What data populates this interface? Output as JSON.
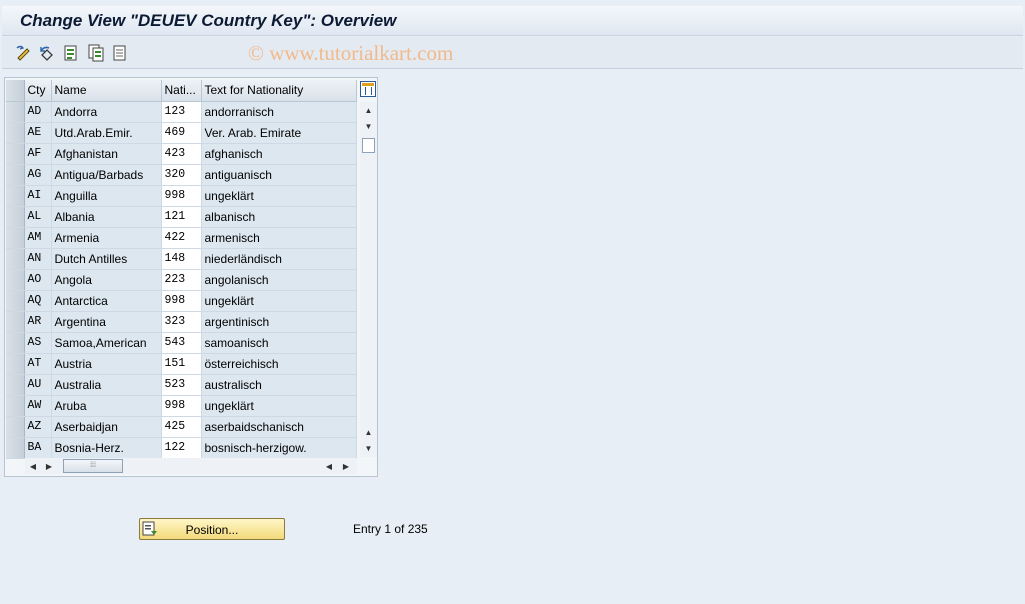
{
  "title": "Change View \"DEUEV Country Key\": Overview",
  "watermark": "© www.tutorialkart.com",
  "toolbar": {
    "icons": [
      "edit-pencil-icon",
      "undo-icon",
      "new-entries-icon",
      "copy-entries-icon",
      "delete-icon"
    ]
  },
  "table": {
    "columns": [
      "Cty",
      "Name",
      "Nati...",
      "Text for Nationality"
    ],
    "rows": [
      {
        "cty": "AD",
        "name": "Andorra",
        "nat": "123",
        "text": "andorranisch"
      },
      {
        "cty": "AE",
        "name": "Utd.Arab.Emir.",
        "nat": "469",
        "text": "Ver. Arab. Emirate"
      },
      {
        "cty": "AF",
        "name": "Afghanistan",
        "nat": "423",
        "text": "afghanisch"
      },
      {
        "cty": "AG",
        "name": "Antigua/Barbads",
        "nat": "320",
        "text": "antiguanisch"
      },
      {
        "cty": "AI",
        "name": "Anguilla",
        "nat": "998",
        "text": "ungeklärt"
      },
      {
        "cty": "AL",
        "name": "Albania",
        "nat": "121",
        "text": "albanisch"
      },
      {
        "cty": "AM",
        "name": "Armenia",
        "nat": "422",
        "text": "armenisch"
      },
      {
        "cty": "AN",
        "name": "Dutch Antilles",
        "nat": "148",
        "text": "niederländisch"
      },
      {
        "cty": "AO",
        "name": "Angola",
        "nat": "223",
        "text": "angolanisch"
      },
      {
        "cty": "AQ",
        "name": "Antarctica",
        "nat": "998",
        "text": "ungeklärt"
      },
      {
        "cty": "AR",
        "name": "Argentina",
        "nat": "323",
        "text": "argentinisch"
      },
      {
        "cty": "AS",
        "name": "Samoa,American",
        "nat": "543",
        "text": "samoanisch"
      },
      {
        "cty": "AT",
        "name": "Austria",
        "nat": "151",
        "text": "österreichisch"
      },
      {
        "cty": "AU",
        "name": "Australia",
        "nat": "523",
        "text": "australisch"
      },
      {
        "cty": "AW",
        "name": "Aruba",
        "nat": "998",
        "text": "ungeklärt"
      },
      {
        "cty": "AZ",
        "name": "Aserbaidjan",
        "nat": "425",
        "text": "aserbaidschanisch"
      },
      {
        "cty": "BA",
        "name": "Bosnia-Herz.",
        "nat": "122",
        "text": "bosnisch-herzigow."
      }
    ]
  },
  "footer": {
    "position_label": "Position...",
    "entry_text": "Entry 1 of 235"
  }
}
